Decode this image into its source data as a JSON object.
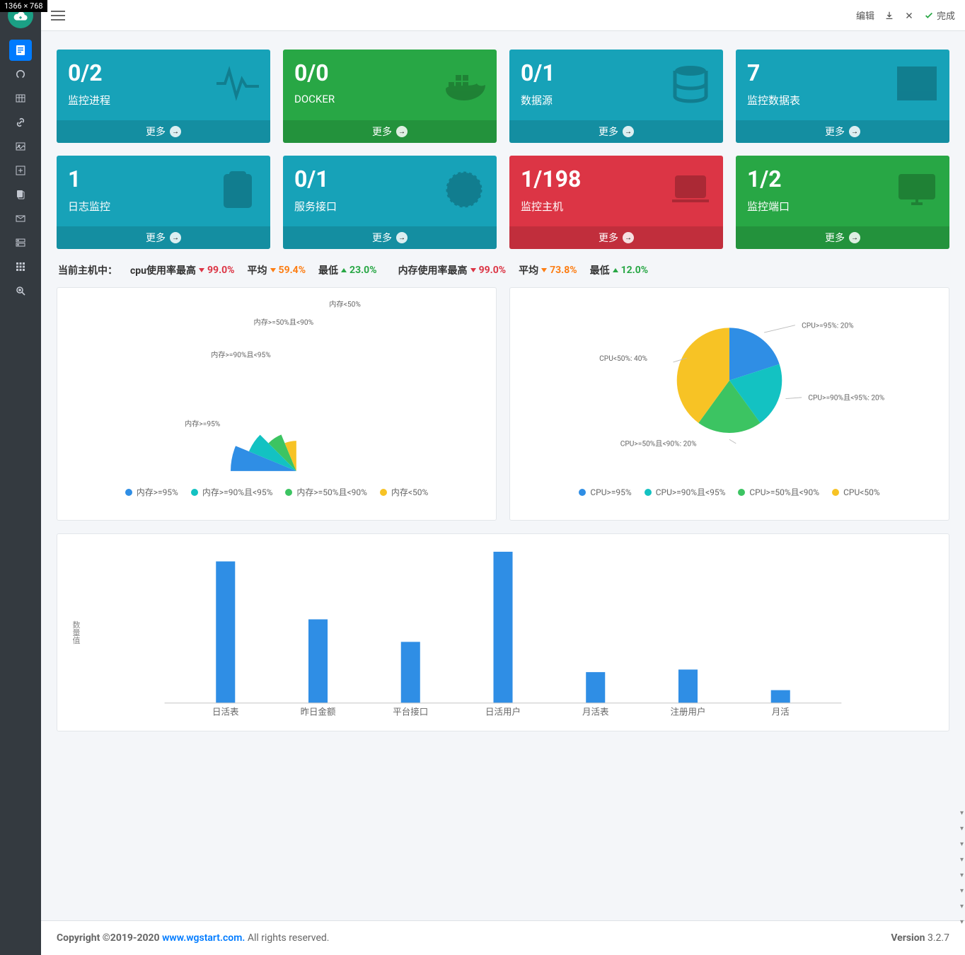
{
  "dim_badge": "1366 × 768",
  "topbar": {
    "edit": "编辑",
    "done": "完成"
  },
  "cards": [
    {
      "value": "0/2",
      "label": "监控进程",
      "more": "更多",
      "color": "c-teal",
      "icon": "pulse"
    },
    {
      "value": "0/0",
      "label": "DOCKER",
      "more": "更多",
      "color": "c-green",
      "icon": "docker"
    },
    {
      "value": "0/1",
      "label": "数据源",
      "more": "更多",
      "color": "c-teal",
      "icon": "db"
    },
    {
      "value": "7",
      "label": "监控数据表",
      "more": "更多",
      "color": "c-teal",
      "icon": "grid"
    },
    {
      "value": "1",
      "label": "日志监控",
      "more": "更多",
      "color": "c-teal",
      "icon": "clipboard"
    },
    {
      "value": "0/1",
      "label": "服务接口",
      "more": "更多",
      "color": "c-teal",
      "icon": "api"
    },
    {
      "value": "1/198",
      "label": "监控主机",
      "more": "更多",
      "color": "c-red",
      "icon": "laptop"
    },
    {
      "value": "1/2",
      "label": "监控端口",
      "more": "更多",
      "color": "c-green",
      "icon": "monitor"
    }
  ],
  "stats": {
    "prefix": "当前主机中：",
    "cpu_max_lbl": "cpu使用率最高",
    "cpu_max_val": "99.0%",
    "avg_lbl": "平均",
    "cpu_avg_val": "59.4%",
    "min_lbl": "最低",
    "cpu_min_val": "23.0%",
    "mem_max_lbl": "内存使用率最高",
    "mem_max_val": "99.0%",
    "mem_avg_val": "73.8%",
    "mem_min_val": "12.0%"
  },
  "chart_data": [
    {
      "type": "pie",
      "style": "nightingale",
      "series_name": "memory",
      "categories": [
        "内存>=95%",
        "内存>=90%且<95%",
        "内存>=50%且<90%",
        "内存<50%"
      ],
      "values": [
        25,
        25,
        25,
        25
      ],
      "radii": [
        100,
        78,
        60,
        46
      ],
      "colors": [
        "#2f8ee5",
        "#13c2c2",
        "#3cc462",
        "#f7c325"
      ],
      "legend": [
        "内存>=95%",
        "内存>=90%且<95%",
        "内存>=50%且<90%",
        "内存<50%"
      ]
    },
    {
      "type": "pie",
      "series_name": "cpu",
      "categories": [
        "CPU>=95%",
        "CPU>=90%且<95%",
        "CPU>=50%且<90%",
        "CPU<50%"
      ],
      "values": [
        20,
        20,
        20,
        40
      ],
      "colors": [
        "#2f8ee5",
        "#13c2c2",
        "#3cc462",
        "#f7c325"
      ],
      "data_labels": [
        "CPU>=95%: 20%",
        "CPU>=90%且<95%: 20%",
        "CPU>=50%且<90%: 20%",
        "CPU<50%: 40%"
      ],
      "legend": [
        "CPU>=95%",
        "CPU>=90%且<95%",
        "CPU>=50%且<90%",
        "CPU<50%"
      ]
    },
    {
      "type": "bar",
      "ylabel": "数量值",
      "categories": [
        "日活表",
        "昨日金额",
        "平台接口",
        "日活用户",
        "月活表",
        "注册用户",
        "月活"
      ],
      "values": [
        220,
        130,
        95,
        235,
        48,
        52,
        20
      ],
      "ylim": [
        0,
        240
      ],
      "color": "#2f8ee5"
    }
  ],
  "footer": {
    "copyright": "Copyright ©2019-2020 ",
    "link": "www.wgstart.com.",
    "rights": " All rights reserved.",
    "version_lbl": "Version ",
    "version": "3.2.7"
  }
}
